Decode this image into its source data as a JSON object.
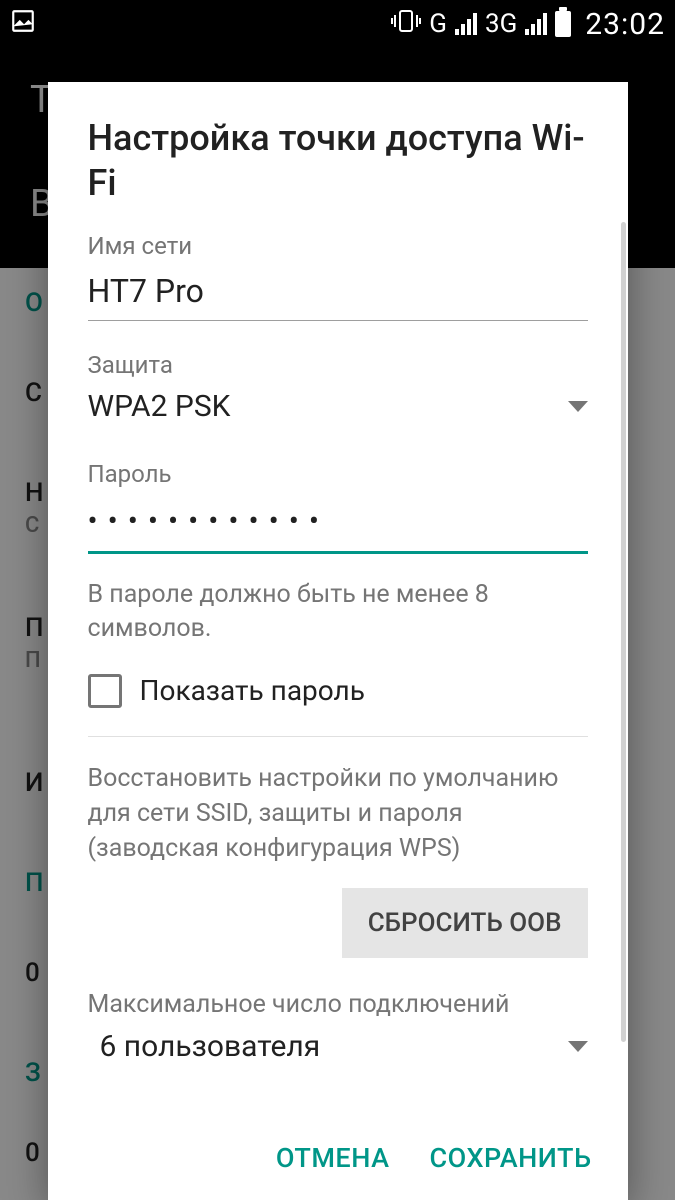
{
  "status_bar": {
    "vibrate_icon": "vibrate",
    "net1_label": "G",
    "net2_label": "3G",
    "time": "23:02"
  },
  "background": {
    "header_line1": "Т",
    "header_line2": "В",
    "labels": [
      "О",
      "С",
      "Н",
      "С",
      "П",
      "П",
      "И",
      "П",
      "0",
      "З",
      "0"
    ]
  },
  "dialog": {
    "title": "Настройка точки доступа Wi-Fi",
    "network_name_label": "Имя сети",
    "network_name_value": "HT7 Pro",
    "security_label": "Защита",
    "security_value": "WPA2 PSK",
    "password_label": "Пароль",
    "password_value": "••••••••••••",
    "password_helper": "В пароле должно быть не менее 8 символов.",
    "show_password_label": "Показать пароль",
    "reset_description": "Восстановить настройки по умолчанию для сети SSID, защиты и пароля (заводская конфигурация WPS)",
    "reset_button": "СБРОСИТЬ OOB",
    "max_connections_label": "Максимальное число подключений",
    "max_connections_value": "6 пользователя",
    "cancel": "ОТМЕНА",
    "save": "СОХРАНИТЬ"
  }
}
